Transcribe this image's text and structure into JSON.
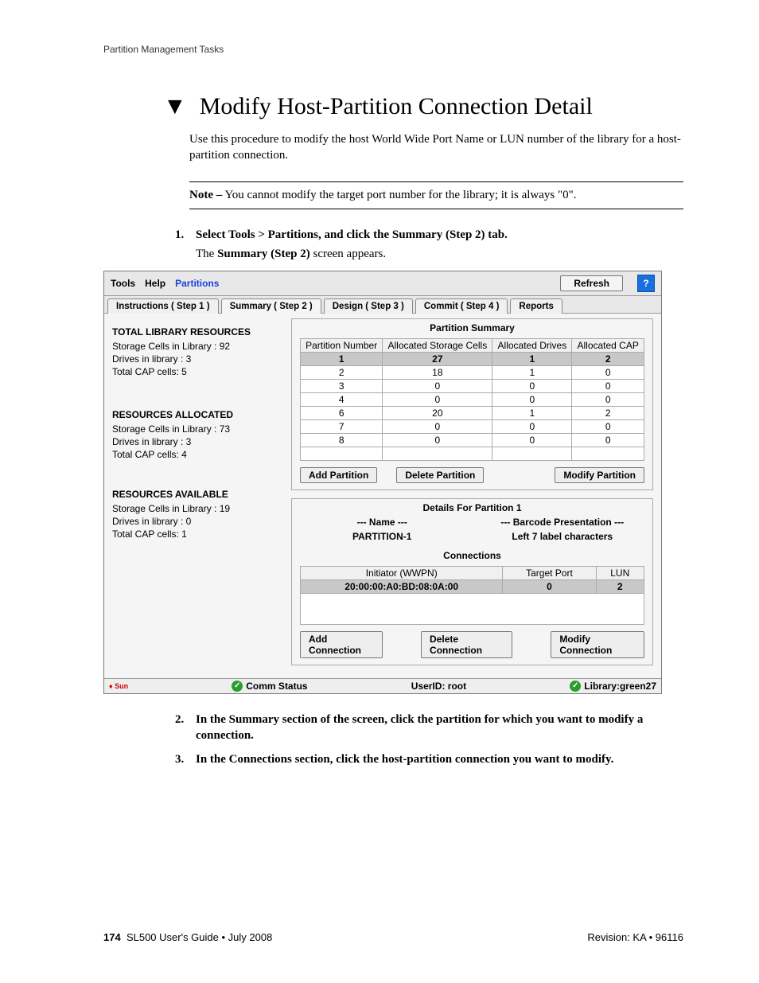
{
  "header": {
    "running": "Partition Management Tasks"
  },
  "title": "Modify Host-Partition Connection Detail",
  "intro": "Use this procedure to modify the host World Wide Port Name or LUN number of the library for a host-partition connection.",
  "note_bold": "Note –",
  "note_rest": " You cannot modify the target port number for the library; it is always \"0\".",
  "steps": {
    "s1": "Select Tools > Partitions, and click the Summary (Step 2) tab.",
    "s1_sub_a": "The ",
    "s1_sub_b": "Summary (Step 2)",
    "s1_sub_c": " screen appears.",
    "s2": "In the Summary section of the screen, click the partition for which you want to modify a connection.",
    "s3": "In the Connections section, click the host-partition connection you want to modify."
  },
  "ui": {
    "menu": {
      "tools": "Tools",
      "help": "Help",
      "partitions": "Partitions",
      "refresh": "Refresh",
      "qmark": "?"
    },
    "tabs": {
      "t1": "Instructions ( Step 1 )",
      "t2": "Summary ( Step 2 )",
      "t3": "Design ( Step 3 )",
      "t4": "Commit ( Step 4 )",
      "t5": "Reports"
    },
    "left": {
      "g1": "TOTAL LIBRARY RESOURCES",
      "g1a": "Storage Cells in Library : 92",
      "g1b": "Drives in library : 3",
      "g1c": "Total CAP cells: 5",
      "g2": "RESOURCES ALLOCATED",
      "g2a": "Storage Cells in Library : 73",
      "g2b": "Drives in library : 3",
      "g2c": "Total CAP cells: 4",
      "g3": "RESOURCES AVAILABLE",
      "g3a": "Storage Cells in Library : 19",
      "g3b": "Drives in library : 0",
      "g3c": "Total CAP cells: 1"
    },
    "summary_panel": {
      "title": "Partition Summary",
      "h1": "Partition Number",
      "h2": "Allocated Storage Cells",
      "h3": "Allocated Drives",
      "h4": "Allocated CAP",
      "rows": [
        {
          "c1": "1",
          "c2": "27",
          "c3": "1",
          "c4": "2",
          "sel": true
        },
        {
          "c1": "2",
          "c2": "18",
          "c3": "1",
          "c4": "0"
        },
        {
          "c1": "3",
          "c2": "0",
          "c3": "0",
          "c4": "0"
        },
        {
          "c1": "4",
          "c2": "0",
          "c3": "0",
          "c4": "0"
        },
        {
          "c1": "6",
          "c2": "20",
          "c3": "1",
          "c4": "2"
        },
        {
          "c1": "7",
          "c2": "0",
          "c3": "0",
          "c4": "0"
        },
        {
          "c1": "8",
          "c2": "0",
          "c3": "0",
          "c4": "0"
        }
      ],
      "add": "Add Partition",
      "del": "Delete Partition",
      "mod": "Modify Partition"
    },
    "details_panel": {
      "title": "Details For Partition 1",
      "name_h": "--- Name ---",
      "barcode_h": "--- Barcode Presentation ---",
      "name_v": "PARTITION-1",
      "barcode_v": "Left 7 label characters",
      "conn_title": "Connections",
      "ch1": "Initiator (WWPN)",
      "ch2": "Target Port",
      "ch3": "LUN",
      "cr1": "20:00:00:A0:BD:08:0A:00",
      "cr2": "0",
      "cr3": "2",
      "addc": "Add Connection",
      "delc": "Delete Connection",
      "modc": "Modify Connection"
    },
    "status": {
      "sun": "♦ Sun",
      "comm": "Comm Status",
      "user": "UserID: root",
      "lib": "Library:green27"
    }
  },
  "footer": {
    "pageno": "174",
    "guide": "SL500 User's Guide  •  July 2008",
    "rev": "Revision: KA  •  96116"
  }
}
